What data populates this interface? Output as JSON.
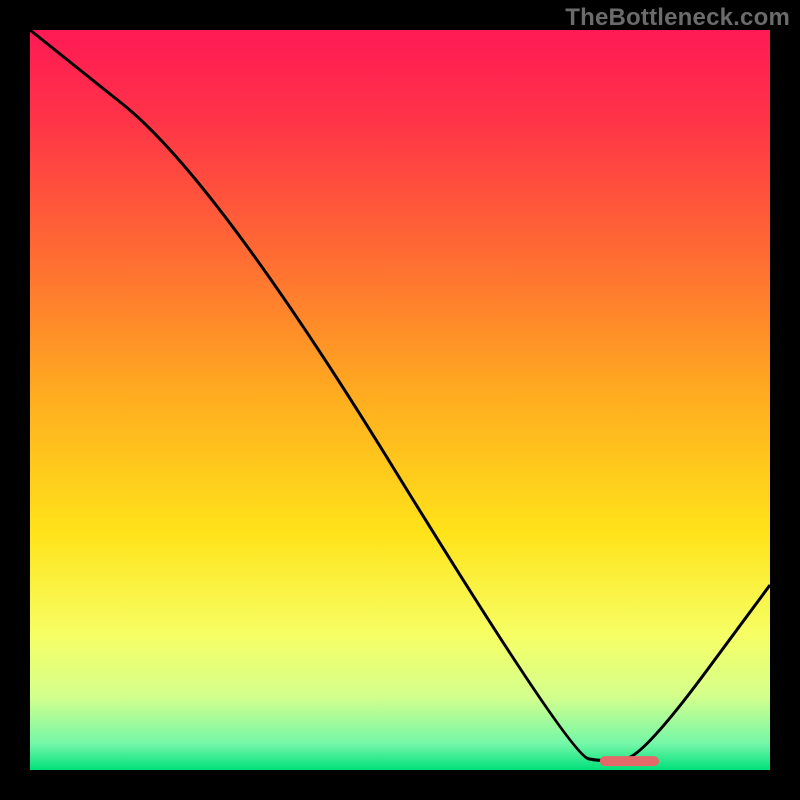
{
  "watermark": "TheBottleneck.com",
  "colors": {
    "background": "#000000",
    "curve_stroke": "#000000",
    "marker_fill": "#e46a6a",
    "gradient_stops": [
      {
        "offset": 0.0,
        "color": "#ff1a55"
      },
      {
        "offset": 0.12,
        "color": "#ff3348"
      },
      {
        "offset": 0.3,
        "color": "#ff6a33"
      },
      {
        "offset": 0.5,
        "color": "#ffae1f"
      },
      {
        "offset": 0.68,
        "color": "#ffe31a"
      },
      {
        "offset": 0.82,
        "color": "#f6ff66"
      },
      {
        "offset": 0.9,
        "color": "#d4ff8c"
      },
      {
        "offset": 0.965,
        "color": "#73f7a8"
      },
      {
        "offset": 1.0,
        "color": "#00e07a"
      }
    ]
  },
  "chart_data": {
    "type": "line",
    "title": "",
    "xlabel": "",
    "ylabel": "",
    "xlim": [
      0,
      100
    ],
    "ylim": [
      0,
      100
    ],
    "x": [
      0,
      25,
      73,
      78,
      83,
      100
    ],
    "values": [
      100,
      80,
      2,
      1,
      2,
      25
    ],
    "marker": {
      "x_start": 77,
      "x_end": 85,
      "y": 1.2
    },
    "grid": false,
    "legend": null
  }
}
